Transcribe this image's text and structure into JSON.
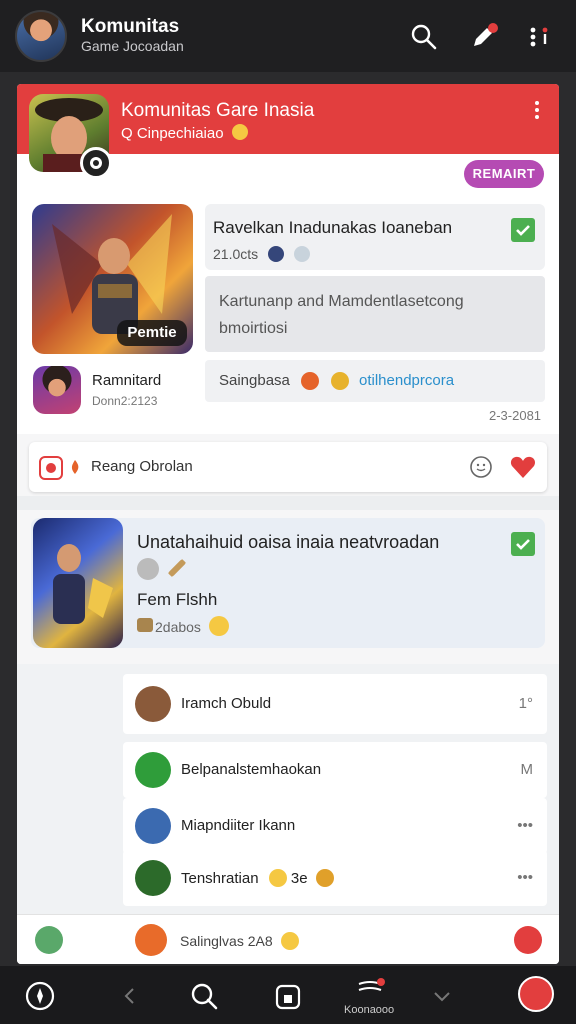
{
  "header": {
    "title": "Komunitas",
    "subtitle": "Game Jocoadan"
  },
  "hero": {
    "title": "Komunitas Gare Inasia",
    "subtitle": "Q Cinpechiaiao"
  },
  "remake_button": "REMAIRT",
  "premium_tag": "Pemtie",
  "user": {
    "name": "Ramnitard",
    "sub": "Donn2:2123"
  },
  "post": {
    "title": "Ravelkan Inadunakas Ioaneban",
    "meta": "21.0cts",
    "body": "Kartunanp and Mamdentlasetcong bmoirtiosi",
    "foot_label": "Saingbasa",
    "foot_link": "otilhendprcora",
    "date": "2-3-2081"
  },
  "chat_row": {
    "label": "Reang Obrolan"
  },
  "card2": {
    "title": "Unatahaihuid oaisa inaia neatvroadan",
    "name": "Fem Flshh",
    "meta": "2dabos"
  },
  "list": [
    {
      "name": "Iramch Obuld",
      "right": "1°",
      "icon": "warrior-avatar",
      "color": "#8a5a3a"
    },
    {
      "name": "Belpanalstemhaokan",
      "right": "M",
      "icon": "green-badge-avatar",
      "color": "#2f9d3a"
    },
    {
      "name": "Miapndiiter Ikann",
      "right": "•••",
      "icon": "blue-avatar",
      "color": "#3b6ab0"
    },
    {
      "name": "Tenshratian",
      "right": "•••",
      "icon": "green-avatar",
      "color": "#2c6a2a"
    }
  ],
  "list_extra": {
    "tenshratian_suffix": "3e"
  },
  "bottom_row": {
    "label": "Salinglvas 2A8"
  },
  "nav": {
    "active_label": "Koonaooo"
  },
  "colors": {
    "accent_red": "#e23e3e",
    "remake_purple": "#b54bb3",
    "check_green": "#4caf50",
    "link_blue": "#2a8fcc"
  }
}
